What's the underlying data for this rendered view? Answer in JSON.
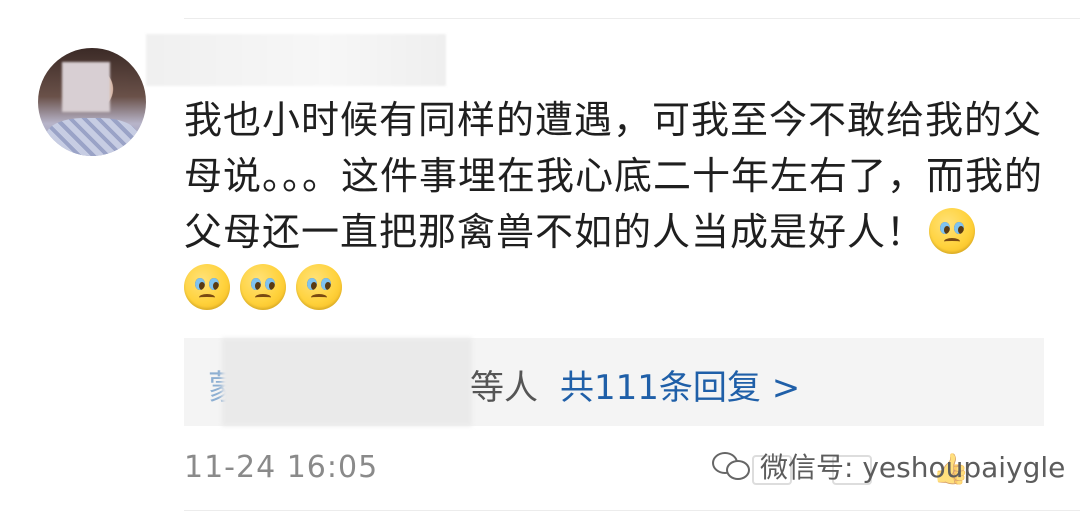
{
  "comment": {
    "text": "我也小时候有同样的遭遇，可我至今不敢给我的父母说。。。这件事埋在我心底二十年左右了，而我的父母还一直把那禽兽不如的人当成是好人！",
    "emojis": [
      "crying-face",
      "crying-face",
      "crying-face",
      "crying-face"
    ],
    "timestamp": "11-24 16:05"
  },
  "replies": {
    "peek_char": "蒙",
    "suffix": "等人",
    "link": "共111条回复 >"
  },
  "watermark": {
    "text": "微信号: yeshoupaiygle"
  }
}
